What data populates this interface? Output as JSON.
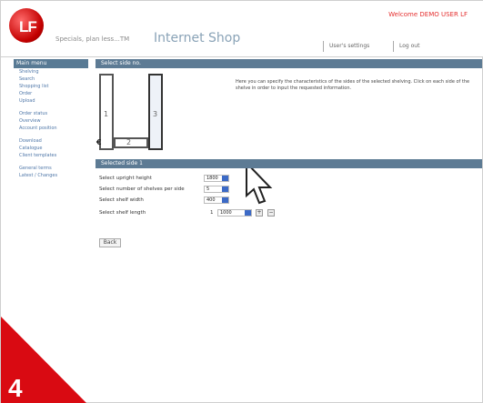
{
  "header": {
    "logo_text": "LF",
    "tagline": "Specials, plan less...TM",
    "title": "Internet Shop",
    "welcome": "Welcome DEMO USER LF",
    "user_settings": "User's settings",
    "logout": "Log out"
  },
  "sidebar": {
    "heading": "Main menu",
    "items": [
      "Shelving",
      "Search",
      "Shopping list",
      "Order",
      "Upload",
      "Order status",
      "Overview",
      "Account position",
      "Download",
      "Catalogue",
      "Client templates",
      "General terms",
      "Latest / Changes"
    ]
  },
  "selection": {
    "heading": "Select side no.",
    "labels": [
      "1",
      "2",
      "3"
    ],
    "description": "Here you can specify the characteristics of the sides of the selected shelving. Click on each side of the shelve in order to input the requested information.",
    "currency": "€"
  },
  "form": {
    "section_title": "Selected side 1",
    "upright_label": "Select upright height",
    "upright_value": "1800",
    "shelves_label": "Select number of shelves per side",
    "shelves_value": "5",
    "width_label": "Select shelf width",
    "width_value": "400",
    "length_label": "Select shelf length",
    "length_prefix": "1",
    "length_value": "1000",
    "plus": "+",
    "minus": "−",
    "back_label": "Back"
  },
  "badge": {
    "step": "4"
  }
}
